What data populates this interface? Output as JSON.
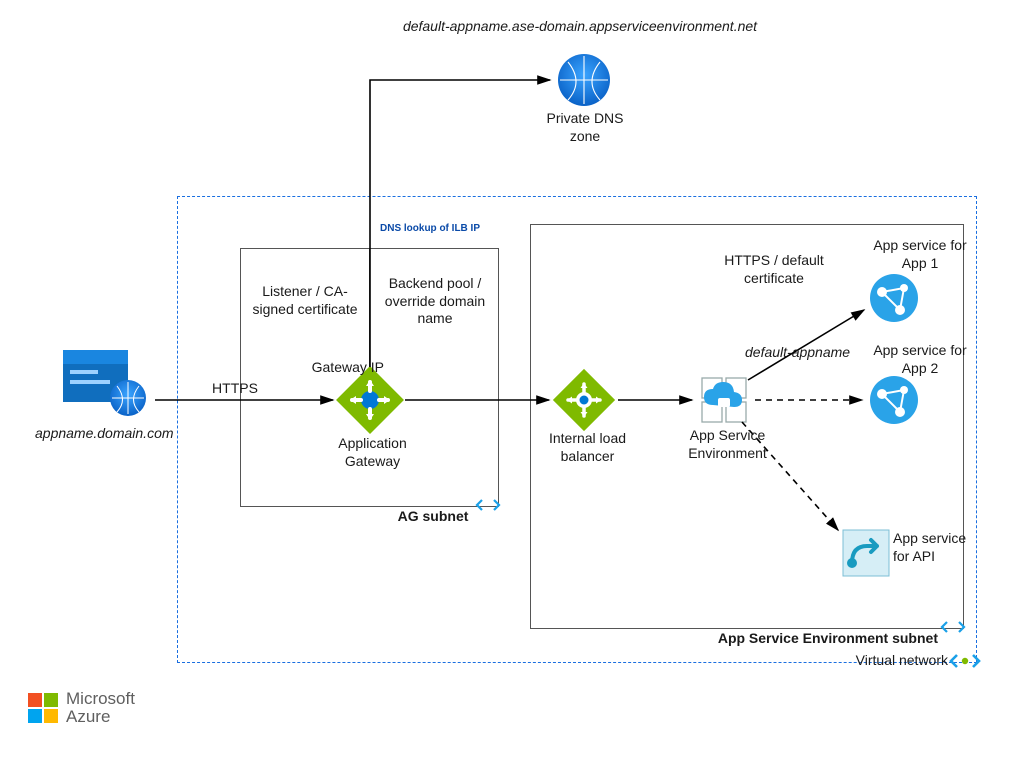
{
  "diagram": {
    "top_domain": "default-appname.ase-domain.appserviceenvironment.net",
    "external_domain": "appname.domain.com",
    "https_label": "HTTPS",
    "gateway_ip_label": "Gateway IP",
    "dns_lookup_label": "DNS lookup of ILB IP",
    "listener_label": "Listener / CA-signed certificate",
    "backend_pool_label": "Backend pool / override domain name",
    "app_gateway_label": "Application Gateway",
    "ilb_label": "Internal load balancer",
    "ase_label": "App Service Environment",
    "https_cert_label": "HTTPS / default certificate",
    "default_appname_label": "default-appname",
    "app1_label": "App service for App 1",
    "app2_label": "App service for App 2",
    "api_label": "App service for API",
    "private_dns_label": "Private DNS zone",
    "ag_subnet_label": "AG subnet",
    "ase_subnet_label": "App Service Environment subnet",
    "vnet_label": "Virtual network"
  },
  "footer": {
    "brand_line1": "Microsoft",
    "brand_line2": "Azure"
  },
  "colors": {
    "azure_blue": "#0078D4",
    "green": "#7FBA00",
    "teal": "#30B1CC",
    "dark_teal": "#0c8aa0"
  }
}
